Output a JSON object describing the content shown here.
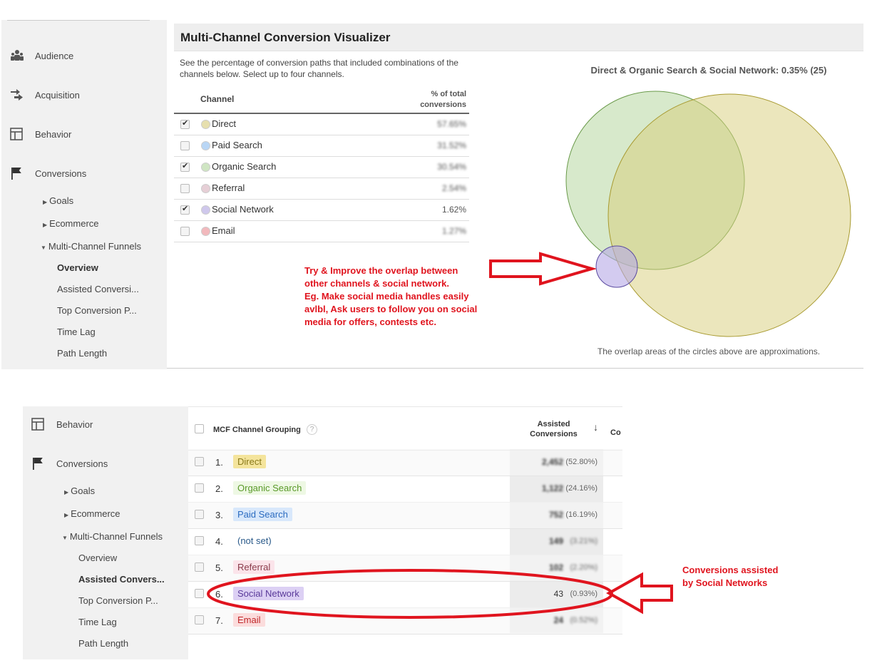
{
  "top": {
    "sidebar": [
      {
        "label": "Audience",
        "icon": "audience-icon"
      },
      {
        "label": "Acquisition",
        "icon": "acquisition-icon"
      },
      {
        "label": "Behavior",
        "icon": "behavior-icon"
      },
      {
        "label": "Conversions",
        "icon": "flag-icon"
      }
    ],
    "subnav": {
      "goals": "Goals",
      "ecommerce": "Ecommerce",
      "mcf": "Multi-Channel Funnels",
      "items": [
        "Overview",
        "Assisted Conversi...",
        "Top Conversion P...",
        "Time Lag",
        "Path Length"
      ],
      "active": "Overview"
    },
    "title": "Multi-Channel Conversion Visualizer",
    "description": "See the percentage of conversion paths that included combinations of the channels below. Select up to four channels.",
    "table": {
      "col_channel": "Channel",
      "col_pct_1": "% of total",
      "col_pct_2": "conversions",
      "rows": [
        {
          "channel": "Direct",
          "pct": "57.65%",
          "checked": true,
          "color": "#e6dfae"
        },
        {
          "channel": "Paid Search",
          "pct": "31.52%",
          "checked": false,
          "color": "#b9d6f5"
        },
        {
          "channel": "Organic Search",
          "pct": "30.54%",
          "checked": true,
          "color": "#cfe5c3"
        },
        {
          "channel": "Referral",
          "pct": "2.54%",
          "checked": false,
          "color": "#e6cfd6"
        },
        {
          "channel": "Social Network",
          "pct": "1.62%",
          "checked": true,
          "color": "#cfc8ec"
        },
        {
          "channel": "Email",
          "pct": "1.27%",
          "checked": false,
          "color": "#f2b9bd"
        }
      ]
    },
    "venn_title": "Direct & Organic Search & Social Network: 0.35% (25)",
    "venn_note": "The overlap areas of the circles above are approximations.",
    "annotation": [
      "Try & Improve the overlap between",
      "other channels & social network.",
      "Eg. Make social media handles easily",
      "avlbl, Ask users to follow you on social",
      "media for offers, contests etc."
    ]
  },
  "bottom": {
    "sidebar": [
      {
        "label": "Behavior",
        "icon": "behavior-icon"
      },
      {
        "label": "Conversions",
        "icon": "flag-icon"
      }
    ],
    "subnav": {
      "goals": "Goals",
      "ecommerce": "Ecommerce",
      "mcf": "Multi-Channel Funnels",
      "items": [
        "Overview",
        "Assisted Convers...",
        "Top Conversion P...",
        "Time Lag",
        "Path Length"
      ],
      "active": "Assisted Convers..."
    },
    "table": {
      "col_group": "MCF Channel Grouping",
      "help": "?",
      "col_assisted_1": "Assisted",
      "col_assisted_2": "Conversions",
      "sort_icon": "arrow-down-icon",
      "col_next": "Co",
      "rows": [
        {
          "n": "1.",
          "channel": "Direct",
          "value": "2,452",
          "pct": "(52.80%)",
          "bg": "#f4e49c",
          "fg": "#8a7a1a"
        },
        {
          "n": "2.",
          "channel": "Organic Search",
          "value": "1,122",
          "pct": "(24.16%)",
          "bg": "#eef8e4",
          "fg": "#5a9a2a"
        },
        {
          "n": "3.",
          "channel": "Paid Search",
          "value": "752",
          "pct": "(16.19%)",
          "bg": "#d8e8fb",
          "fg": "#2c6cc0"
        },
        {
          "n": "4.",
          "channel": "(not set)",
          "value": "149",
          "pct": "(3.21%)",
          "bg": "transparent",
          "fg": "#2a5a8a"
        },
        {
          "n": "5.",
          "channel": "Referral",
          "value": "102",
          "pct": "(2.20%)",
          "bg": "#fbe4ea",
          "fg": "#8a3a4a"
        },
        {
          "n": "6.",
          "channel": "Social Network",
          "value": "43",
          "pct": "(0.93%)",
          "bg": "#dcd0f4",
          "fg": "#5a3a9a"
        },
        {
          "n": "7.",
          "channel": "Email",
          "value": "24",
          "pct": "(0.52%)",
          "bg": "#fbdcdc",
          "fg": "#c0282a"
        }
      ]
    },
    "annotation": [
      "Conversions assisted",
      "by Social Networks"
    ]
  },
  "colors": {
    "annotation": "#e0141e"
  }
}
